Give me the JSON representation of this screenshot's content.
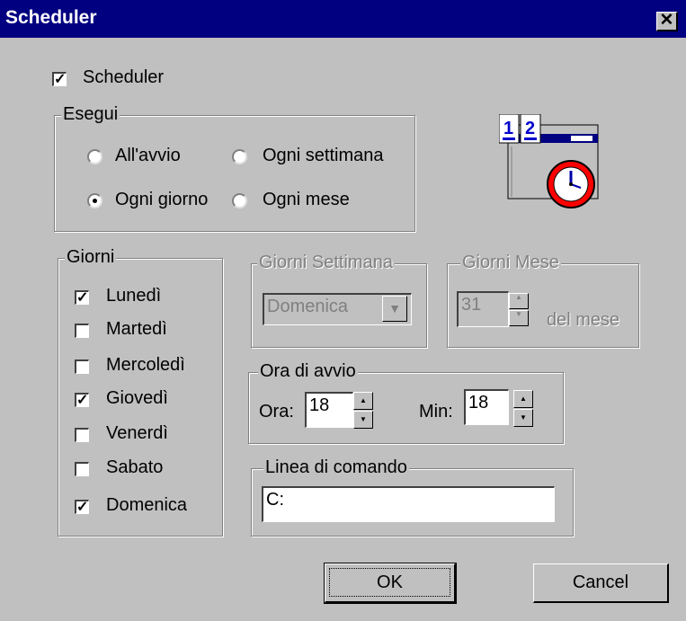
{
  "window": {
    "title": "Scheduler",
    "close_glyph": "✕"
  },
  "scheduler_checkbox": {
    "label": "Scheduler",
    "checked": true
  },
  "esegui": {
    "title": "Esegui",
    "options": [
      {
        "label": "All'avvio",
        "selected": false
      },
      {
        "label": "Ogni settimana",
        "selected": false
      },
      {
        "label": "Ogni giorno",
        "selected": true
      },
      {
        "label": "Ogni mese",
        "selected": false
      }
    ]
  },
  "giorni": {
    "title": "Giorni",
    "days": [
      {
        "label": "Lunedì",
        "checked": true
      },
      {
        "label": "Martedì",
        "checked": false
      },
      {
        "label": "Mercoledì",
        "checked": false
      },
      {
        "label": "Giovedì",
        "checked": true
      },
      {
        "label": "Venerdì",
        "checked": false
      },
      {
        "label": "Sabato",
        "checked": false
      },
      {
        "label": "Domenica",
        "checked": true
      }
    ]
  },
  "giorni_settimana": {
    "title": "Giorni Settimana",
    "value": "Domenica"
  },
  "giorni_mese": {
    "title": "Giorni Mese",
    "value": "31",
    "suffix": "del mese"
  },
  "ora_avvio": {
    "title": "Ora di avvio",
    "ora_label": "Ora:",
    "ora_value": "18",
    "min_label": "Min:",
    "min_value": "18"
  },
  "linea_comando": {
    "title": "Linea di comando",
    "value": "C:"
  },
  "buttons": {
    "ok": "OK",
    "cancel": "Cancel"
  },
  "icon": {
    "name": "calendar-clock-icon",
    "day1": "1",
    "day2": "2"
  }
}
